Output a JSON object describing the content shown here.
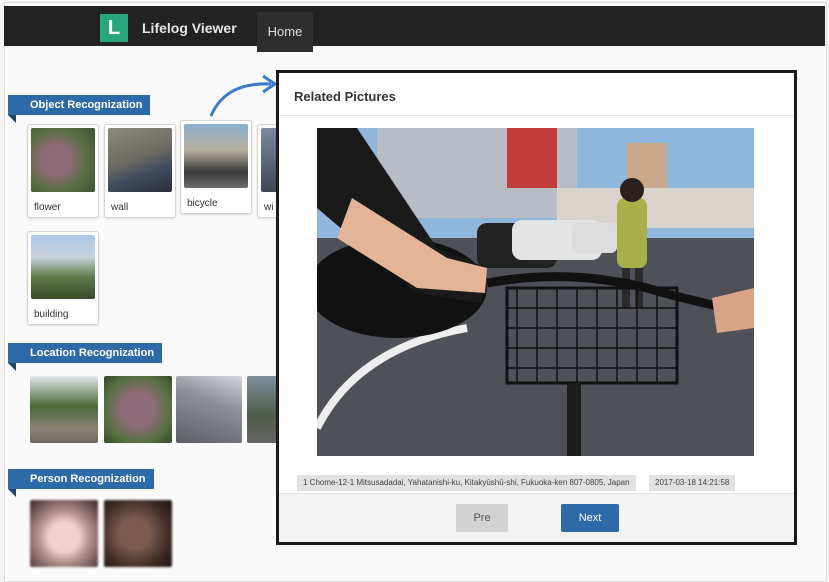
{
  "app": {
    "logo_letter": "L",
    "title": "Lifelog Viewer",
    "nav_home": "Home"
  },
  "sections": {
    "object": {
      "title": "Object Recognization",
      "cards": [
        {
          "label": "flower"
        },
        {
          "label": "wall"
        },
        {
          "label": "bicycle"
        },
        {
          "label": "wi"
        },
        {
          "label": "building"
        }
      ]
    },
    "location": {
      "title": "Location Recognization"
    },
    "person": {
      "title": "Person Recognization"
    }
  },
  "modal": {
    "title": "Related Pictures",
    "address": "1 Chome-12-1 Mitsusadadai, Yahatanishi-ku, Kitakyūshū-shi, Fukuoka-ken 807-0805, Japan",
    "timestamp": "2017-03-18 14:21:58",
    "pre_label": "Pre",
    "next_label": "Next"
  },
  "colors": {
    "accent": "#2d6ba8",
    "logo": "#2aa67e",
    "navbar": "#222222"
  }
}
